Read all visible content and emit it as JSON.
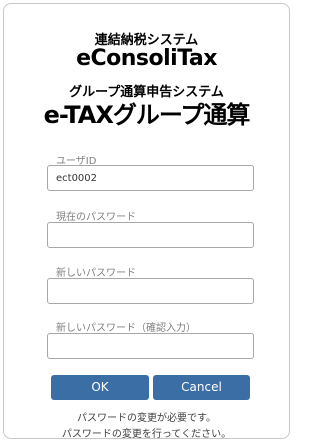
{
  "logo": {
    "subtitle_1": "連結納税システム",
    "title_1": "eConsoliTax",
    "subtitle_2": "グループ通算申告システム",
    "title_2": "e-TAXグループ通算"
  },
  "form": {
    "user_id": {
      "label": "ユーザID",
      "value": "ect0002"
    },
    "current_password": {
      "label": "現在のパスワード",
      "value": ""
    },
    "new_password": {
      "label": "新しいパスワード",
      "value": ""
    },
    "confirm_password": {
      "label": "新しいパスワード（確認入力）",
      "value": ""
    }
  },
  "buttons": {
    "ok_label": "OK",
    "cancel_label": "Cancel"
  },
  "message": {
    "line_1": "パスワードの変更が必要です。",
    "line_2": "パスワードの変更を行ってください。"
  },
  "colors": {
    "button": "#3a6ea5",
    "label": "#808080"
  }
}
